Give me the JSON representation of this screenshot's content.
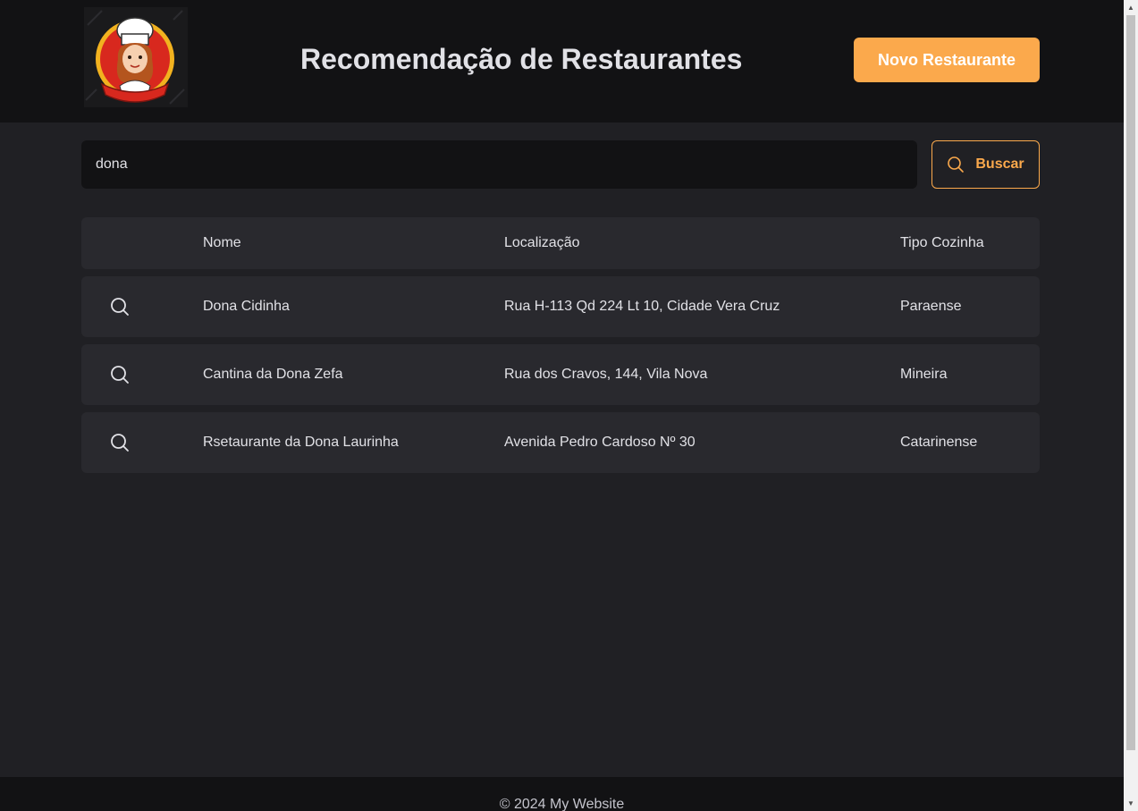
{
  "header": {
    "title": "Recomendação de Restaurantes",
    "new_button_label": "Novo Restaurante"
  },
  "search": {
    "value": "dona",
    "button_label": "Buscar",
    "icon": "search-icon"
  },
  "table": {
    "columns": [
      "Nome",
      "Localização",
      "Tipo Cozinha"
    ],
    "rows": [
      {
        "icon": "search-icon",
        "nome": "Dona Cidinha",
        "localizacao": "Rua H-113 Qd 224 Lt 10, Cidade Vera Cruz",
        "tipo": "Paraense"
      },
      {
        "icon": "search-icon",
        "nome": "Cantina da Dona Zefa",
        "localizacao": "Rua dos Cravos, 144, Vila Nova",
        "tipo": "Mineira"
      },
      {
        "icon": "search-icon",
        "nome": "Rsetaurante da Dona Laurinha",
        "localizacao": "Avenida Pedro Cardoso Nº 30",
        "tipo": "Catarinense"
      }
    ]
  },
  "footer": {
    "text": "© 2024 My Website"
  },
  "colors": {
    "accent": "#fba94c",
    "background": "#202024",
    "header_bg": "#121214",
    "row_bg": "#29292e"
  }
}
